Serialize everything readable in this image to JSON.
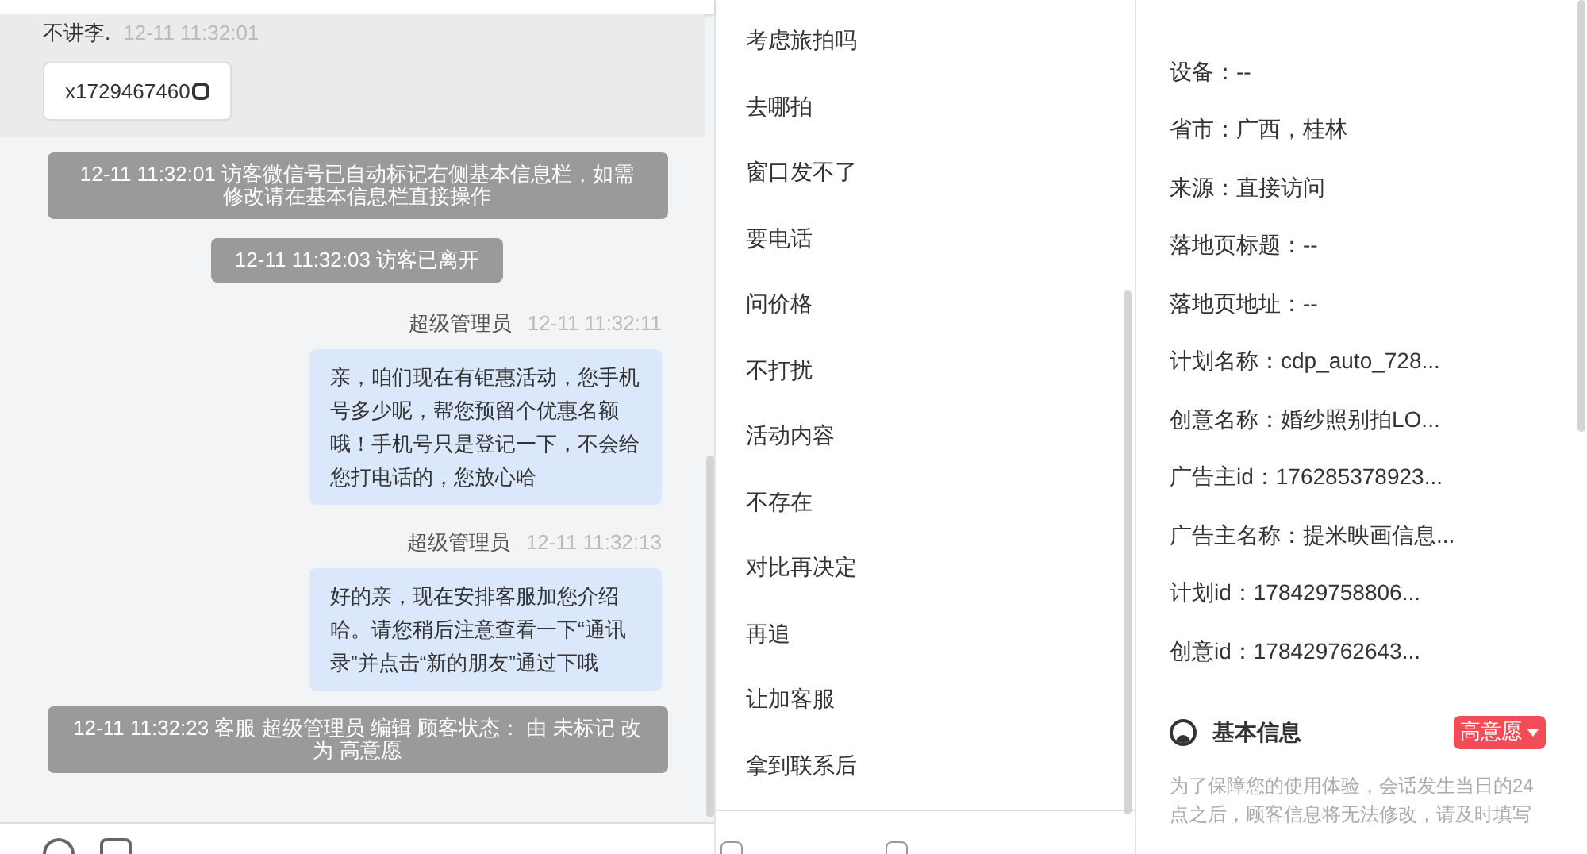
{
  "chat": {
    "visitor": {
      "name": "不讲李.",
      "time": "12-11 11:32:01",
      "wechat": "x1729467460"
    },
    "messages": [
      {
        "kind": "system",
        "text": "12-11 11:32:01 访客微信号已自动标记右侧基本信息栏，如需修改请在基本信息栏直接操作"
      },
      {
        "kind": "system",
        "text": "12-11 11:32:03 访客已离开"
      },
      {
        "kind": "agent",
        "sender": "超级管理员",
        "time": "12-11 11:32:11",
        "text": "亲，咱们现在有钜惠活动，您手机号多少呢，帮您预留个优惠名额哦！手机号只是登记一下，不会给您打电话的，您放心哈"
      },
      {
        "kind": "agent",
        "sender": "超级管理员",
        "time": "12-11 11:32:13",
        "text": "好的亲，现在安排客服加您介绍哈。请您稍后注意查看一下“通讯录”并点击“新的朋友”通过下哦"
      },
      {
        "kind": "system",
        "text": "12-11 11:32:23 客服 超级管理员 编辑 顾客状态： 由 未标记 改为 高意愿"
      }
    ]
  },
  "quick_replies": [
    "考虑旅拍吗",
    "去哪拍",
    "窗口发不了",
    "要电话",
    "问价格",
    "不打扰",
    "活动内容",
    "不存在",
    "对比再决定",
    "再追",
    "让加客服",
    "拿到联系后"
  ],
  "source_info": [
    "设备：--",
    "省市：广西，桂林",
    "来源：直接访问",
    "落地页标题：--",
    "落地页地址：--",
    "计划名称：cdp_auto_728...",
    "创意名称：婚纱照别拍LO...",
    "广告主id：176285378923...",
    "广告主名称：提米映画信息...",
    "计划id：178429758806...",
    "创意id：178429762643..."
  ],
  "bottom_checkboxes": [
    {
      "checked": false
    },
    {
      "checked": false
    }
  ],
  "basic_info": {
    "title": "基本信息",
    "status_tag": "高意愿",
    "notice": "为了保障您的使用体验，会话发生当日的24点之后，顾客信息将无法修改，请及时填写"
  }
}
